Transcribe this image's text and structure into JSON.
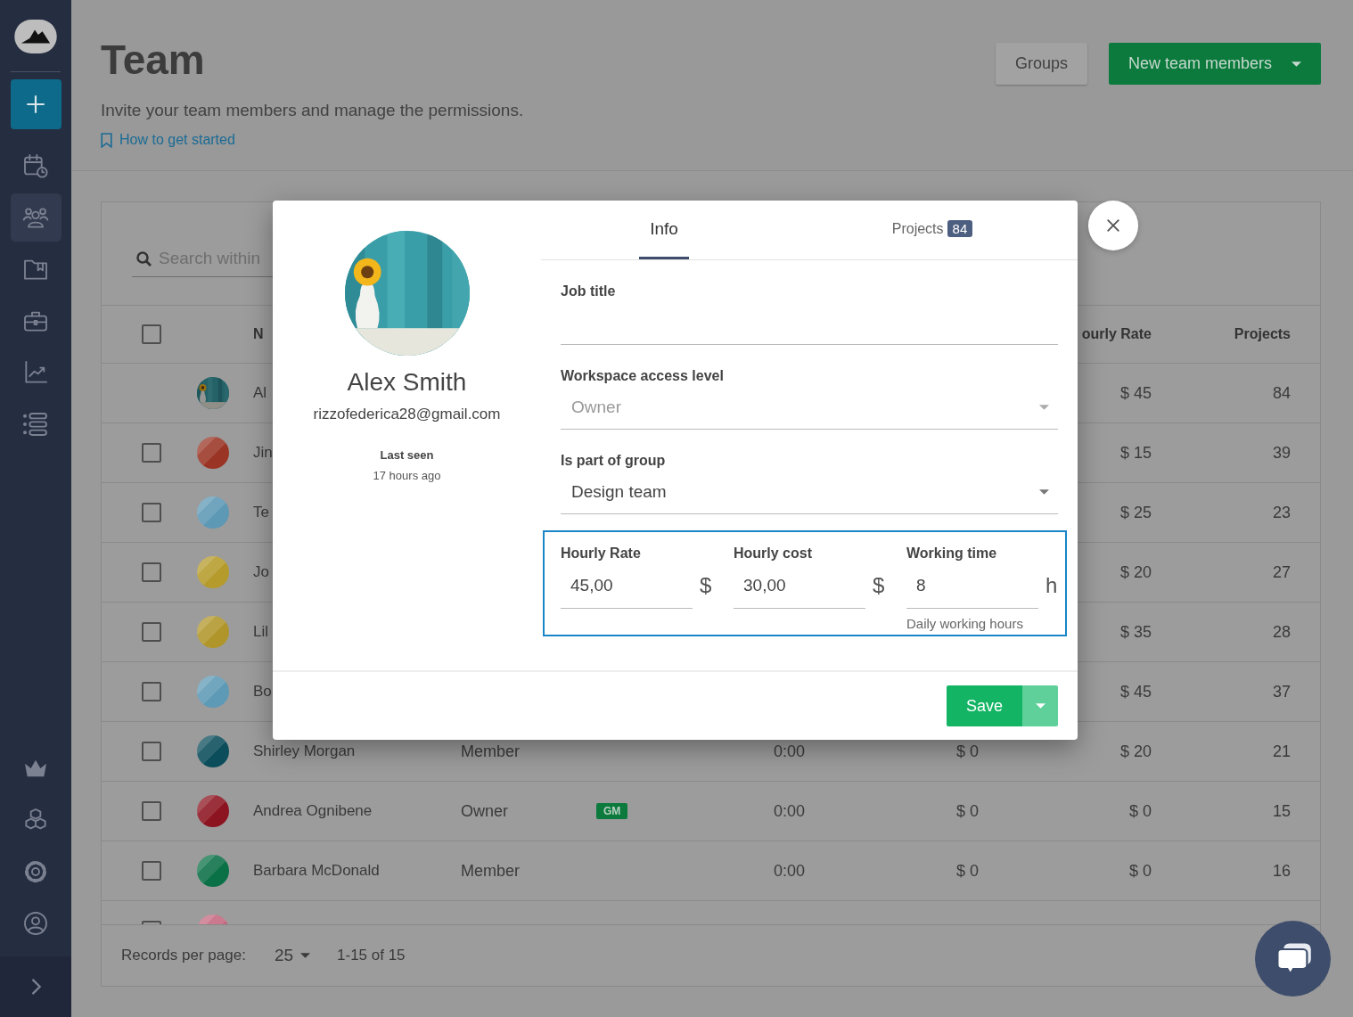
{
  "sidebar": {
    "nav": [
      {
        "kind": "calendar",
        "selected": false
      },
      {
        "kind": "team",
        "selected": true
      },
      {
        "kind": "folder",
        "selected": false
      },
      {
        "kind": "briefcase",
        "selected": false
      },
      {
        "kind": "chart",
        "selected": false
      },
      {
        "kind": "list",
        "selected": false
      }
    ]
  },
  "page_header": {
    "title": "Team",
    "subtitle": "Invite your team members and manage the permissions.",
    "help_link": "How to get started",
    "buttons": [
      {
        "kind": "secondary",
        "label": "Groups"
      },
      {
        "kind": "primary",
        "label": "New team members",
        "dropdown": true
      }
    ]
  },
  "table": {
    "search": {
      "placeholder": "Search within"
    },
    "header": {
      "checked": false,
      "column_3": "N",
      "column_8": "ourly Rate",
      "column_9": "Projects"
    },
    "rows": [
      {
        "column_3": "Al",
        "column_8": "$ 45",
        "column_9": "84"
      },
      {
        "checked": false,
        "avatar": {
          "kind": "swatch",
          "color": "#9a3526"
        },
        "column_3": "Jin",
        "column_8": "$ 15",
        "column_9": "39"
      },
      {
        "checked": false,
        "avatar": {
          "kind": "swatch",
          "color": "#5d98b5"
        },
        "column_3": "Te",
        "column_8": "$ 25",
        "column_9": "23"
      },
      {
        "checked": false,
        "avatar": {
          "kind": "swatch",
          "color": "#b59b2b"
        },
        "column_3": "Jo",
        "column_8": "$ 20",
        "column_9": "27"
      },
      {
        "checked": false,
        "avatar": {
          "kind": "swatch",
          "color": "#b0962a"
        },
        "column_3": "Lil",
        "column_8": "$ 35",
        "column_9": "28"
      },
      {
        "checked": false,
        "avatar": {
          "kind": "swatch",
          "color": "#5e9ab6"
        },
        "column_3": "Bo",
        "column_8": "$ 45",
        "column_9": "37"
      },
      {
        "checked": false,
        "avatar": {
          "kind": "swatch",
          "color": "#0b4d5b"
        },
        "column_3": "Shirley Morgan",
        "column_4": "Member",
        "column_6": "0:00",
        "column_7": "$ 0",
        "column_8": "$ 20",
        "column_9": "21"
      },
      {
        "checked": false,
        "avatar": {
          "kind": "swatch",
          "color": "#8c1420"
        },
        "column_3": "Andrea Ognibene",
        "column_4": "Owner",
        "column_5": "GM",
        "column_6": "0:00",
        "column_7": "$ 0",
        "column_8": "$ 0",
        "column_9": "15"
      },
      {
        "checked": false,
        "avatar": {
          "kind": "swatch",
          "color": "#0a7046"
        },
        "column_3": "Barbara McDonald",
        "column_4": "Member",
        "column_6": "0:00",
        "column_7": "$ 0",
        "column_8": "$ 0",
        "column_9": "16"
      },
      {
        "checked": false,
        "avatar": {
          "kind": "swatch",
          "color": "#c4677e"
        }
      }
    ],
    "footer": {
      "label": "Records per page:",
      "per_page": "25",
      "range": "1-15 of 15"
    }
  },
  "modal": {
    "profile": {
      "name": "Alex Smith",
      "email": "rizzofederica28@gmail.com",
      "last_seen_label": "Last seen",
      "last_seen": "17 hours ago"
    },
    "tabs": [
      {
        "label": "Info",
        "selected": true
      },
      {
        "label": "Projects",
        "count": "84",
        "selected": false
      }
    ],
    "fields": [
      {
        "kind": "text",
        "label": "Job title"
      },
      {
        "kind": "select",
        "label": "Workspace access level",
        "value": "Owner",
        "disabled": true
      },
      {
        "kind": "select",
        "label": "Is part of group",
        "value": "Design team",
        "disabled": false
      }
    ],
    "rates": {
      "focused": true,
      "items": [
        {
          "label": "Hourly Rate",
          "value": "45,00",
          "unit": "$"
        },
        {
          "label": "Hourly cost",
          "value": "30,00",
          "unit": "$"
        },
        {
          "label": "Working time",
          "value": "8",
          "unit": "h",
          "hint": "Daily working hours"
        }
      ]
    },
    "save": {
      "label": "Save",
      "dropdown": true
    }
  }
}
